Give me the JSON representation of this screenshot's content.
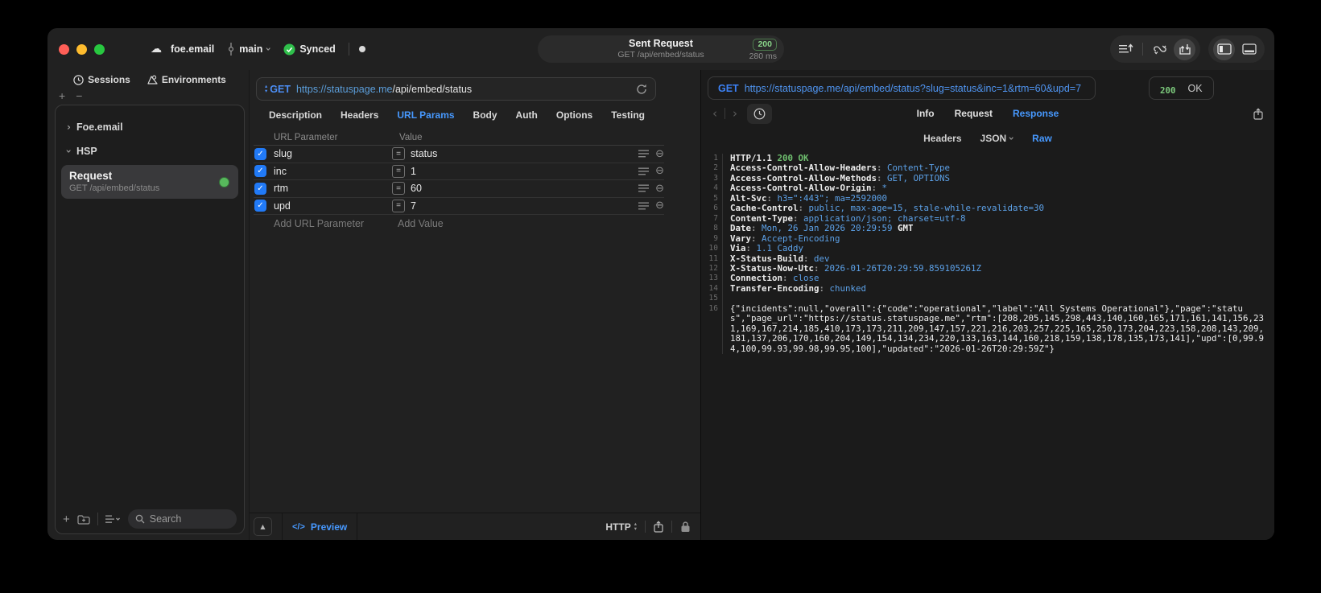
{
  "window": {
    "project": "foe.email",
    "branch": "main",
    "sync_status": "Synced",
    "title": "Sent Request",
    "subtitle": "GET /api/embed/status",
    "status_code": "200",
    "duration": "280 ms",
    "accent_blue": "#4799ff",
    "accent_green": "#7cc97c"
  },
  "sidebar": {
    "tabs": [
      {
        "label": "Sessions",
        "icon": "clock-icon"
      },
      {
        "label": "Environments",
        "icon": "environments-icon"
      }
    ],
    "tree": [
      {
        "label": "Foe.email",
        "expanded": false
      },
      {
        "label": "HSP",
        "expanded": true
      }
    ],
    "request_item": {
      "title": "Request",
      "subtitle": "GET /api/embed/status",
      "selected": true
    },
    "search_placeholder": "Search"
  },
  "request_pane": {
    "method": "GET",
    "url_scheme_host": "https://statuspage.me",
    "url_path": "/api/embed/status",
    "tabs": [
      "Description",
      "Headers",
      "URL Params",
      "Body",
      "Auth",
      "Options",
      "Testing"
    ],
    "active_tab": "URL Params",
    "table": {
      "columns": [
        "URL Parameter",
        "Value"
      ],
      "rows": [
        {
          "checked": true,
          "name": "slug",
          "value": "status"
        },
        {
          "checked": true,
          "name": "inc",
          "value": "1"
        },
        {
          "checked": true,
          "name": "rtm",
          "value": "60"
        },
        {
          "checked": true,
          "name": "upd",
          "value": "7"
        }
      ],
      "add_name_placeholder": "Add URL Parameter",
      "add_value_placeholder": "Add Value"
    },
    "bottom": {
      "preview_label": "Preview",
      "code_glyph": "</>",
      "protocol": "HTTP"
    }
  },
  "response_pane": {
    "method": "GET",
    "url": "https://statuspage.me/api/embed/status?slug=status&inc=1&rtm=60&upd=7",
    "status_code": "200",
    "status_text": "OK",
    "tabs": [
      "Info",
      "Request",
      "Response"
    ],
    "active_tab": "Response",
    "subtabs": [
      "Headers",
      "JSON",
      "Raw"
    ],
    "active_subtab": "Raw",
    "code_lines": [
      {
        "n": 1,
        "parts": [
          [
            "HTTP/1.1 ",
            "n"
          ],
          [
            "200 OK",
            "g"
          ]
        ]
      },
      {
        "n": 2,
        "parts": [
          [
            "Access-Control-Allow-Headers",
            "n"
          ],
          [
            ": ",
            "d"
          ],
          [
            "Content-Type",
            "b"
          ]
        ]
      },
      {
        "n": 3,
        "parts": [
          [
            "Access-Control-Allow-Methods",
            "n"
          ],
          [
            ": ",
            "d"
          ],
          [
            "GET, OPTIONS",
            "b"
          ]
        ]
      },
      {
        "n": 4,
        "parts": [
          [
            "Access-Control-Allow-Origin",
            "n"
          ],
          [
            ": ",
            "d"
          ],
          [
            "*",
            "b"
          ]
        ]
      },
      {
        "n": 5,
        "parts": [
          [
            "Alt-Svc",
            "n"
          ],
          [
            ": ",
            "d"
          ],
          [
            "h3=\":443\"; ma=2592000",
            "b"
          ]
        ]
      },
      {
        "n": 6,
        "parts": [
          [
            "Cache-Control",
            "n"
          ],
          [
            ": ",
            "d"
          ],
          [
            "public, max-age=15, stale-while-revalidate=30",
            "b"
          ]
        ]
      },
      {
        "n": 7,
        "parts": [
          [
            "Content-Type",
            "n"
          ],
          [
            ": ",
            "d"
          ],
          [
            "application/json; charset=utf-8",
            "b"
          ]
        ]
      },
      {
        "n": 8,
        "parts": [
          [
            "Date",
            "n"
          ],
          [
            ": ",
            "d"
          ],
          [
            "Mon, 26 Jan 2026 20:29:59",
            "b"
          ],
          [
            " GMT",
            "n"
          ]
        ]
      },
      {
        "n": 9,
        "parts": [
          [
            "Vary",
            "n"
          ],
          [
            ": ",
            "d"
          ],
          [
            "Accept-Encoding",
            "b"
          ]
        ]
      },
      {
        "n": 10,
        "parts": [
          [
            "Via",
            "n"
          ],
          [
            ": ",
            "d"
          ],
          [
            "1.1 Caddy",
            "b"
          ]
        ]
      },
      {
        "n": 11,
        "parts": [
          [
            "X-Status-Build",
            "n"
          ],
          [
            ": ",
            "d"
          ],
          [
            "dev",
            "b"
          ]
        ]
      },
      {
        "n": 12,
        "parts": [
          [
            "X-Status-Now-Utc",
            "n"
          ],
          [
            ": ",
            "d"
          ],
          [
            "2026-01-26T20:29:59.859105261Z",
            "b"
          ]
        ]
      },
      {
        "n": 13,
        "parts": [
          [
            "Connection",
            "n"
          ],
          [
            ": ",
            "d"
          ],
          [
            "close",
            "b"
          ]
        ]
      },
      {
        "n": 14,
        "parts": [
          [
            "Transfer-Encoding",
            "n"
          ],
          [
            ": ",
            "d"
          ],
          [
            "chunked",
            "b"
          ]
        ]
      },
      {
        "n": 15,
        "parts": []
      },
      {
        "n": 16,
        "parts": [
          [
            "{\"incidents\":null,\"overall\":{\"code\":\"operational\",\"label\":\"All Systems Operational\"},\"page\":\"status\",\"page_url\":\"https://status.statuspage.me\",\"rtm\":[208,205,145,298,443,140,160,165,171,161,141,156,231,169,167,214,185,410,173,173,211,209,147,157,221,216,203,257,225,165,250,173,204,223,158,208,143,209,181,137,206,170,160,204,149,154,134,234,220,133,163,144,160,218,159,138,178,135,173,141],\"upd\":[0,99.94,100,99.93,99.98,99.95,100],\"updated\":\"2026-01-26T20:29:59Z\"}",
            "w"
          ]
        ]
      }
    ]
  }
}
